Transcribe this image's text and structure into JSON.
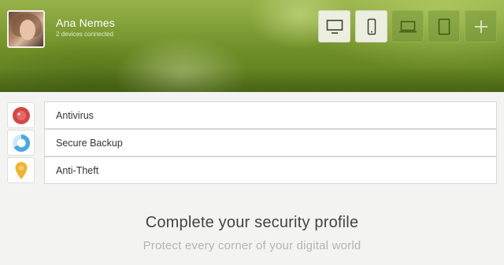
{
  "user": {
    "name": "Ana Nemes",
    "status": "2 devices connected"
  },
  "device_toolbar": {
    "buttons": [
      {
        "icon": "monitor-icon",
        "state": "active"
      },
      {
        "icon": "phone-icon",
        "state": "active"
      },
      {
        "icon": "laptop-icon",
        "state": "inactive"
      },
      {
        "icon": "tablet-icon",
        "state": "inactive"
      },
      {
        "icon": "plus-icon",
        "state": "inactive"
      }
    ]
  },
  "features": [
    {
      "label": "Antivirus",
      "icon": "antivirus-icon",
      "color": "#d64545"
    },
    {
      "label": "Secure Backup",
      "icon": "backup-icon",
      "color": "#4aa8e0"
    },
    {
      "label": "Anti-Theft",
      "icon": "location-pin-icon",
      "color": "#f2b233"
    }
  ],
  "promo": {
    "title": "Complete your security profile",
    "subtitle": "Protect every corner of your digital world"
  }
}
